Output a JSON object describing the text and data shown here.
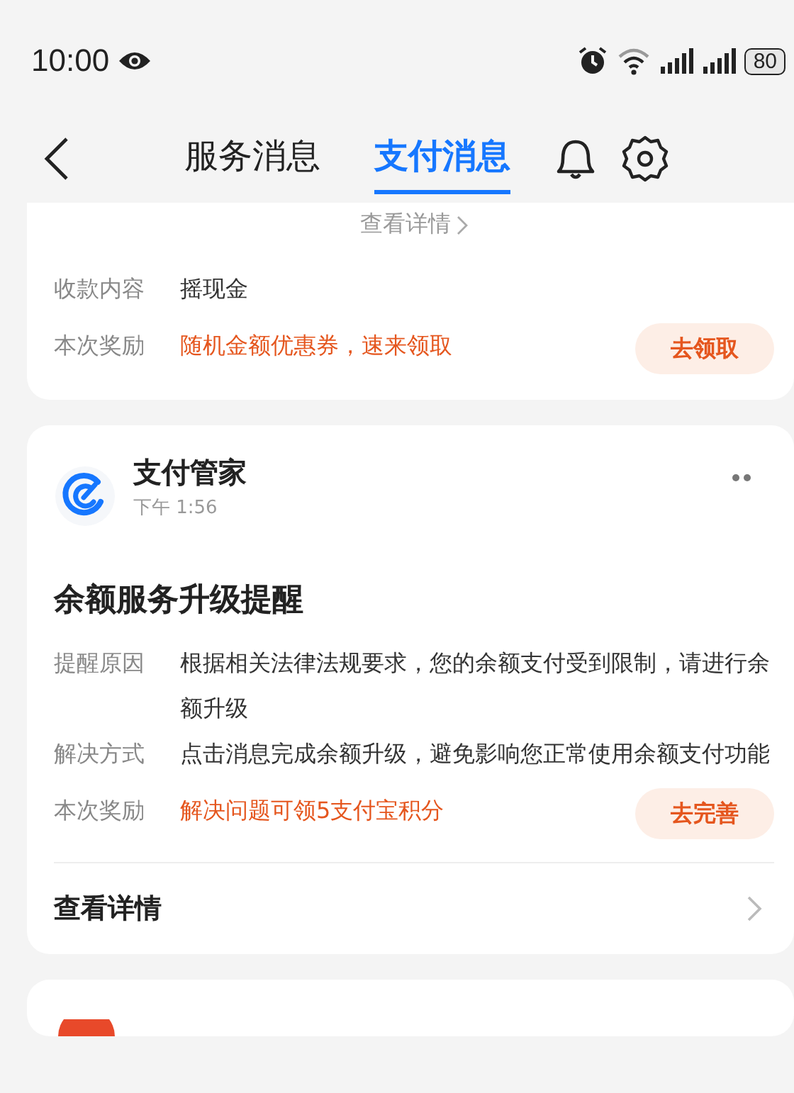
{
  "status_bar": {
    "time": "10:00",
    "battery": "80"
  },
  "header": {
    "tabs": [
      {
        "label": "服务消息",
        "selected": false
      },
      {
        "label": "支付消息",
        "selected": true
      }
    ]
  },
  "cards": [
    {
      "view_details": "查看详情",
      "rows": [
        {
          "label": "收款内容",
          "value": "摇现金",
          "kind": "plain"
        },
        {
          "label": "本次奖励",
          "value": "随机金额优惠券，速来领取",
          "kind": "reward"
        }
      ],
      "action": "去领取"
    },
    {
      "sender": "支付管家",
      "time": "下午 1:56",
      "title": "余额服务升级提醒",
      "rows": [
        {
          "label": "提醒原因",
          "value": "根据相关法律法规要求，您的余额支付受到限制，请进行余额升级",
          "kind": "plain"
        },
        {
          "label": "解决方式",
          "value": "点击消息完成余额升级，避免影响您正常使用余额支付功能",
          "kind": "plain"
        },
        {
          "label": "本次奖励",
          "value": "解决问题可领5支付宝积分",
          "kind": "reward"
        }
      ],
      "action": "去完善",
      "footer_link": "查看详情"
    }
  ]
}
